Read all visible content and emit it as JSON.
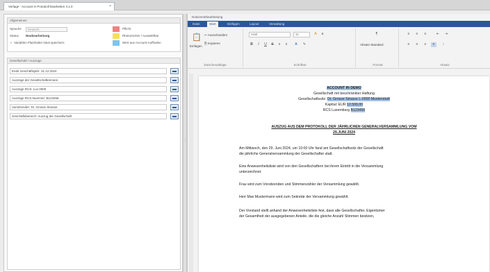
{
  "window": {
    "tab_title": "Verlage - Account in Protokoll bearbeiten 4.1.0",
    "tab_close": "×"
  },
  "left": {
    "general": {
      "title": "Allgemeines",
      "sprache_label": "Sprache",
      "sprache_value": "Deutsch",
      "status_label": "Status",
      "status_value": "Neubearbeitung",
      "checkbox_label": "Variablen Platzhalter lokal speichern",
      "legend": [
        {
          "label": "Pflicht",
          "color": "#f08080"
        },
        {
          "label": "Rhetorischer / Auswählbar",
          "color": "#f5e05a"
        },
        {
          "label": "Wert aus Account-Auffinden",
          "color": "#7fc4ee"
        }
      ]
    },
    "fields": {
      "title": "Gesellschaft / Auszüge",
      "items": [
        "Ende Geschäftsjahr: 31.12.2024",
        "Auszüge der Gesellschafterinnen",
        "Auszüge RCS: Lux 0000",
        "Auszüge RCS-Nummer: B123456",
        "Vorsitzender: Dr. Grosse Strasse",
        "Geschäftsbereich: Auszug der Gesellschaft"
      ]
    }
  },
  "right": {
    "title": "Dokumentbearbeitung",
    "ribbon_tabs": [
      "Datei",
      "Start",
      "Einfügen",
      "Layout",
      "Verwaltung"
    ],
    "active_tab": "Start",
    "ribbon": {
      "paste_label": "Einfügen",
      "cut_label": "Ausschneiden",
      "copy_label": "Kopieren",
      "clipboard_group": "Zwischenablage",
      "font_name": "Arial",
      "font_size": "11",
      "font_group": "Schriftart",
      "paragraph_group": "Absatz",
      "style_label": "Absatz-Standard",
      "style_group": "Format"
    },
    "document": {
      "company_name": "ACCOUNT IN DEMO",
      "company_type": "Gesellschaft mit beschränkter Haftung",
      "address_prefix": "Gesellschaftssitz:",
      "address_value": "Dr. Grosse Strasse L-0000 Musterstadt",
      "capital_prefix": "Kapital: EUR",
      "capital_value": "12.500,00",
      "rcs_prefix": "RCS Luxemburg",
      "rcs_value": "B123456",
      "heading_1": "AUSZUG AUS DEM PROTOKOLL DER JÄHRLICHEN GENERALVERSAMMLUNG VOM",
      "heading_2": "29.JUNI 2024",
      "para_1a": "Am Mittwoch, den 29. Juni 2024, um 10:00 Uhr fand am Gesellschaftssitz der Gesellschaft",
      "para_1b": "die jährliche Generalversammlung der Gesellschafter statt.",
      "para_2a": "Eine Anwesenheitsliste wird von den Gesellschaftern bei ihrem Eintritt in die Versammlung",
      "para_2b": "unterzeichnet.",
      "para_3": "Frau wird zum Vorsitzenden und Stimmenzähler der Versammlung gewählt.",
      "para_4": "Herr Max Mustermann wird zum Sekretär der Versammlung gewählt.",
      "para_5a": "Der Vorstand stellt anhand der Anwesenheitsliste fest, dass alle Gesellschafter, Eigentümer",
      "para_5b": "der Gesamtheit der ausgegebenen Anteile, die die gleiche Anzahl Stimmen besitzen,"
    }
  }
}
